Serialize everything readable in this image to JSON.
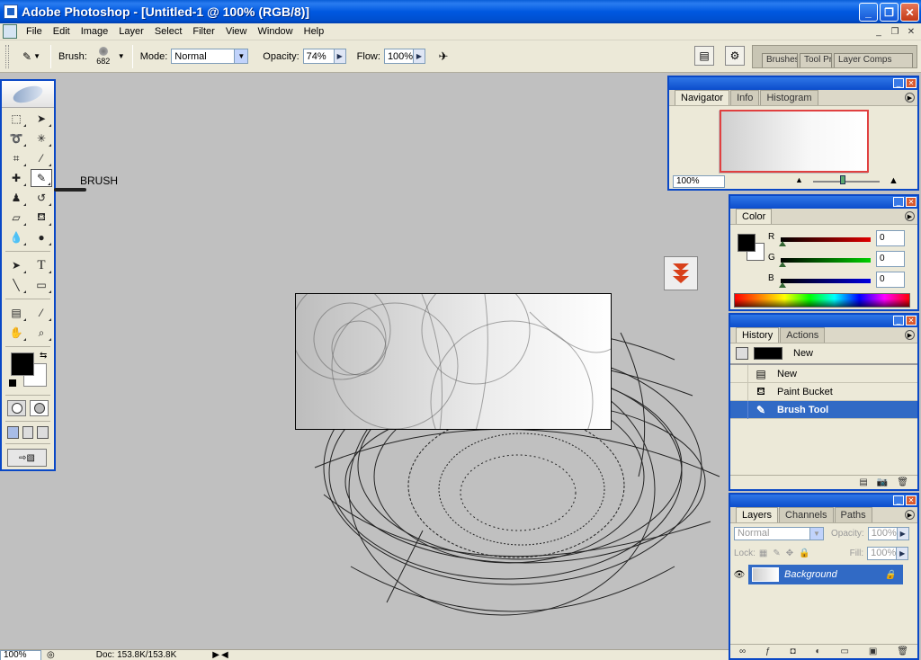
{
  "window": {
    "title": "Adobe Photoshop - [Untitled-1 @ 100% (RGB/8)]"
  },
  "menu": [
    "File",
    "Edit",
    "Image",
    "Layer",
    "Select",
    "Filter",
    "View",
    "Window",
    "Help"
  ],
  "options": {
    "brush_label": "Brush:",
    "brush_size": "682",
    "mode_label": "Mode:",
    "mode_value": "Normal",
    "opacity_label": "Opacity:",
    "opacity_value": "74%",
    "flow_label": "Flow:",
    "flow_value": "100%"
  },
  "palette_well": [
    "Brushes",
    "Tool Pr",
    "Layer Comps"
  ],
  "canvas": {
    "annotation": "BRUSH"
  },
  "navigator": {
    "tabs": [
      "Navigator",
      "Info",
      "Histogram"
    ],
    "zoom": "100%"
  },
  "color": {
    "tab": "Color",
    "channels": [
      {
        "label": "R",
        "value": "0",
        "color": "#d00000"
      },
      {
        "label": "G",
        "value": "0",
        "color": "#00b000"
      },
      {
        "label": "B",
        "value": "0",
        "color": "#0000d0"
      }
    ]
  },
  "history": {
    "tabs": [
      "History",
      "Actions"
    ],
    "snapshot": "New",
    "items": [
      {
        "label": "New",
        "icon": "document-icon"
      },
      {
        "label": "Paint Bucket",
        "icon": "paint-bucket-icon"
      },
      {
        "label": "Brush Tool",
        "icon": "brush-icon"
      }
    ]
  },
  "layers": {
    "tabs": [
      "Layers",
      "Channels",
      "Paths"
    ],
    "blend_mode": "Normal",
    "opacity_label": "Opacity:",
    "opacity_value": "100%",
    "lock_label": "Lock:",
    "fill_label": "Fill:",
    "fill_value": "100%",
    "layer_name": "Background"
  },
  "status": {
    "zoom": "100%",
    "doc": "Doc: 153.8K/153.8K"
  }
}
